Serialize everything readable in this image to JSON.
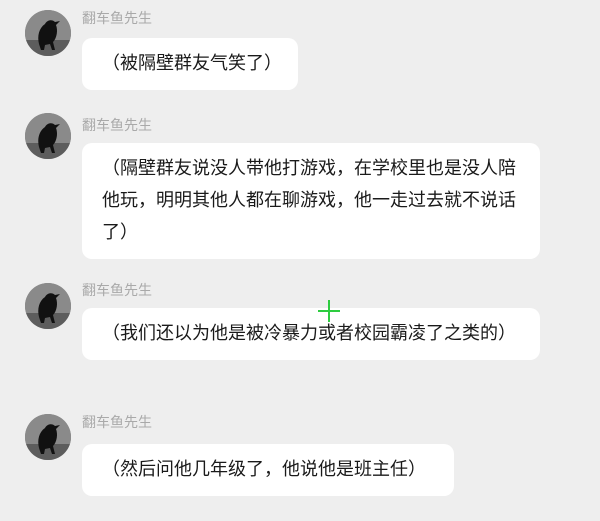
{
  "messages": [
    {
      "sender": "翻车鱼先生",
      "text": "（被隔壁群友气笑了）",
      "avatar_icon": "crow-avatar-icon"
    },
    {
      "sender": "翻车鱼先生",
      "text": "（隔壁群友说没人带他打游戏，在学校里也是没人陪他玩，明明其他人都在聊游戏，他一走过去就不说话了）",
      "avatar_icon": "crow-avatar-icon"
    },
    {
      "sender": "翻车鱼先生",
      "text": "（我们还以为他是被冷暴力或者校园霸凌了之类的）",
      "avatar_icon": "crow-avatar-icon"
    },
    {
      "sender": "翻车鱼先生",
      "text": "（然后问他几年级了，他说他是班主任）",
      "avatar_icon": "crow-avatar-icon"
    }
  ],
  "colors": {
    "background": "#eeeeee",
    "bubble": "#ffffff",
    "sender_text": "#a9a9a9",
    "cursor": "#2ecc40"
  }
}
